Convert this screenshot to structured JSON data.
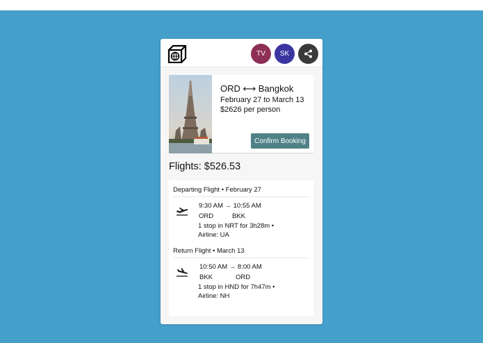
{
  "header": {
    "avatars": [
      {
        "initials": "TV",
        "color": "#8e3056"
      },
      {
        "initials": "SK",
        "color": "#3a35a0"
      }
    ],
    "share_icon": "share-icon",
    "logo_icon": "globe-box-icon"
  },
  "trip": {
    "title": "ORD ⟷ Bangkok",
    "dates": "February 27 to March 13",
    "price": "$2626 per person",
    "confirm_label": "Confirm Booking"
  },
  "flights": {
    "title": "Flights: $526.53",
    "departing": {
      "heading": "Departing Flight • February 27",
      "times": "9:30 AM → 10:55 AM",
      "from": "ORD",
      "to": "BKK",
      "stops": "1 stop in NRT for 3h28m •",
      "airline": "Airline: UA",
      "icon": "plane-takeoff-icon"
    },
    "return": {
      "heading": "Return Flight • March 13",
      "times": "10:50 AM → 8:00 AM",
      "from": "BKK",
      "to": "ORD",
      "stops": "1 stop in HND for 7h47m •",
      "airline": "Airline: NH",
      "icon": "plane-landing-icon"
    }
  },
  "colors": {
    "background": "#459fcb",
    "confirm_button": "#4f8186"
  }
}
